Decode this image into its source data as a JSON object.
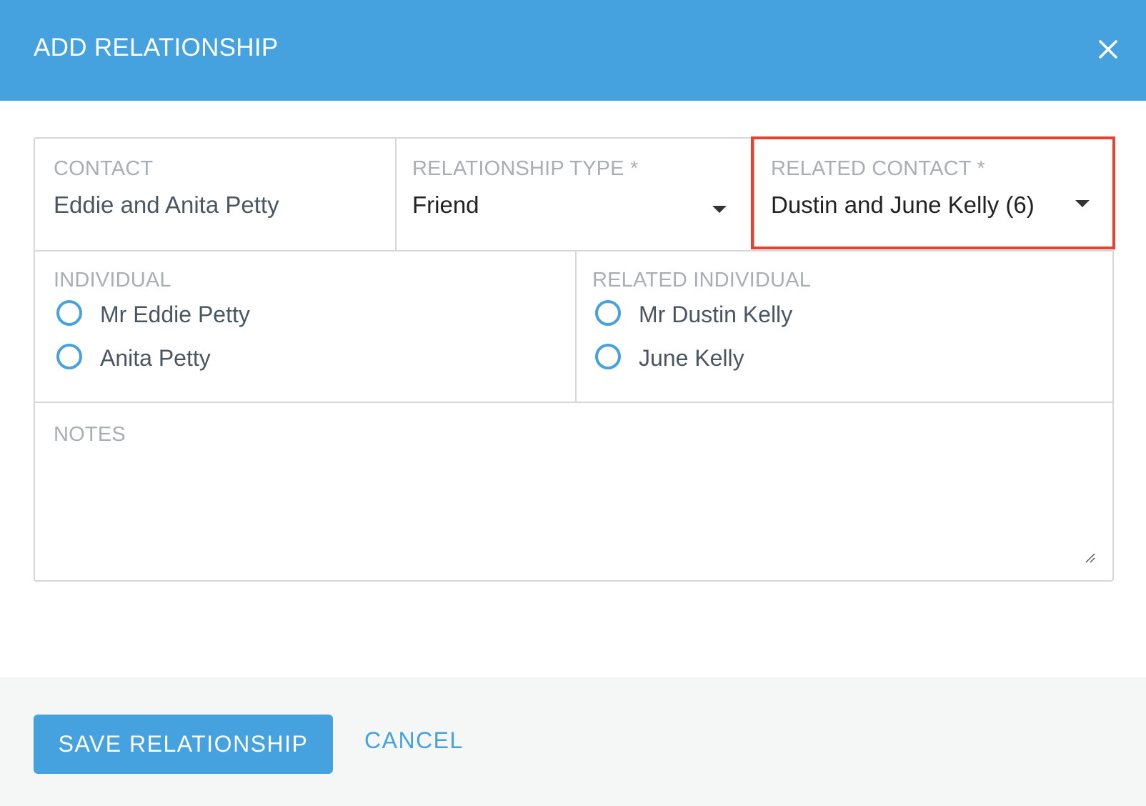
{
  "dialog": {
    "title": "ADD RELATIONSHIP",
    "close_icon": "close-icon"
  },
  "form": {
    "contact": {
      "label": "CONTACT",
      "value": "Eddie and Anita Petty"
    },
    "relationship_type": {
      "label": "RELATIONSHIP TYPE *",
      "value": "Friend",
      "icon": "chevron-down-icon"
    },
    "related_contact": {
      "label": "RELATED CONTACT *",
      "value": "Dustin and June Kelly (6)",
      "icon": "chevron-down-icon",
      "highlight_color": "#e5432f"
    },
    "individual": {
      "label": "INDIVIDUAL",
      "options": [
        "Mr Eddie Petty",
        "Anita Petty"
      ]
    },
    "related_individual": {
      "label": "RELATED INDIVIDUAL",
      "options": [
        "Mr Dustin Kelly",
        "June Kelly"
      ]
    },
    "notes": {
      "label": "NOTES",
      "value": ""
    }
  },
  "footer": {
    "save_label": "SAVE RELATIONSHIP",
    "cancel_label": "CANCEL"
  },
  "colors": {
    "accent": "#46a2df",
    "highlight": "#e5432f",
    "footer_bg": "#f5f6f6"
  }
}
